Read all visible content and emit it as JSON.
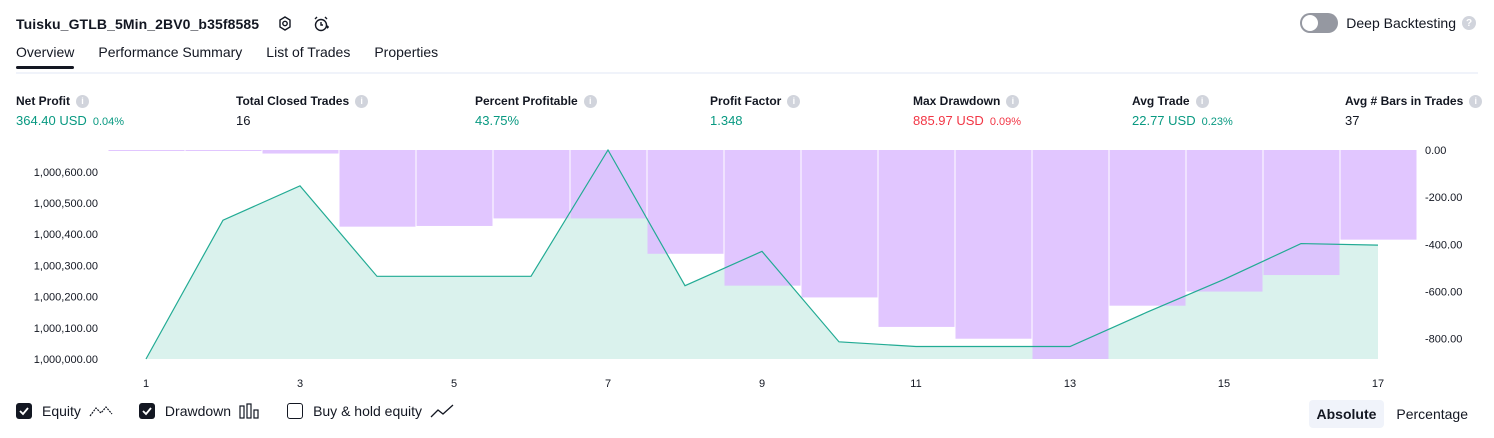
{
  "header": {
    "strategy_name": "Tuisku_GTLB_5Min_2BV0_b35f8585",
    "deep_backtesting_label": "Deep Backtesting"
  },
  "tabs": [
    "Overview",
    "Performance Summary",
    "List of Trades",
    "Properties"
  ],
  "metrics": [
    {
      "label": "Net Profit",
      "value": "364.40 USD",
      "pct": "0.04%",
      "color": "#089981"
    },
    {
      "label": "Total Closed Trades",
      "value": "16",
      "pct": "",
      "color": "#131722"
    },
    {
      "label": "Percent Profitable",
      "value": "43.75%",
      "pct": "",
      "color": "#089981"
    },
    {
      "label": "Profit Factor",
      "value": "1.348",
      "pct": "",
      "color": "#089981"
    },
    {
      "label": "Max Drawdown",
      "value": "885.97 USD",
      "pct": "0.09%",
      "color": "#f23645"
    },
    {
      "label": "Avg Trade",
      "value": "22.77 USD",
      "pct": "0.23%",
      "color": "#089981"
    },
    {
      "label": "Avg # Bars in Trades",
      "value": "37",
      "pct": "",
      "color": "#131722"
    }
  ],
  "legend": {
    "equity_label": "Equity",
    "drawdown_label": "Drawdown",
    "buyhold_label": "Buy & hold equity"
  },
  "modes": {
    "absolute_label": "Absolute",
    "percentage_label": "Percentage"
  },
  "colors": {
    "equity": "#22ab94",
    "equity_fill": "#d6f1eb",
    "drawdown": "#dcbcff",
    "text": "#131722"
  },
  "chart_data": {
    "type": "area",
    "x": [
      1,
      2,
      3,
      4,
      5,
      6,
      7,
      8,
      9,
      10,
      11,
      12,
      13,
      14,
      15,
      16,
      17
    ],
    "x_ticks": [
      "1",
      "3",
      "5",
      "7",
      "9",
      "11",
      "13",
      "15",
      "17"
    ],
    "series": [
      {
        "name": "Equity",
        "axis": "left",
        "values": [
          1000000,
          1000445,
          1000555,
          1000265,
          1000265,
          1000265,
          1000670,
          1000235,
          1000345,
          1000055,
          1000040,
          1000040,
          1000040,
          1000150,
          1000255,
          1000370,
          1000365
        ]
      },
      {
        "name": "Drawdown",
        "axis": "right",
        "values": [
          -2,
          -3,
          -15,
          -325,
          -322,
          -290,
          -290,
          -440,
          -575,
          -625,
          -750,
          -800,
          -886,
          -660,
          -600,
          -530,
          -380
        ]
      }
    ],
    "left_axis": {
      "ticks": [
        "1,000,600.00",
        "1,000,500.00",
        "1,000,400.00",
        "1,000,300.00",
        "1,000,200.00",
        "1,000,100.00",
        "1,000,000.00"
      ],
      "range": [
        1000000,
        1000670
      ]
    },
    "right_axis": {
      "ticks": [
        "0.00",
        "-200.00",
        "-400.00",
        "-600.00",
        "-800.00"
      ],
      "range": [
        -886,
        0
      ]
    }
  }
}
